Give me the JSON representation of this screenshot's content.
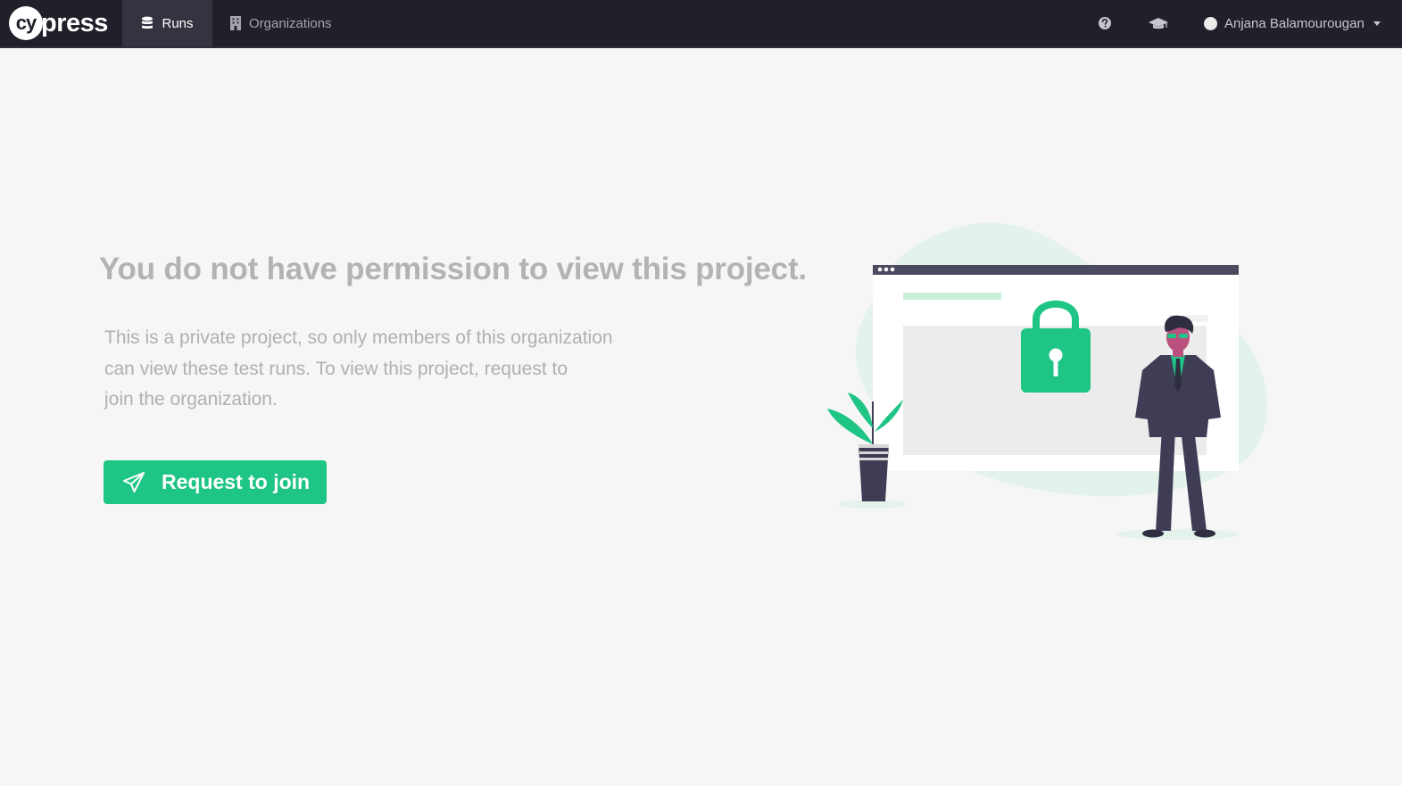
{
  "brand": {
    "logo_mark": "cy",
    "logo_text": "press"
  },
  "nav": {
    "items": [
      {
        "label": "Runs",
        "icon": "database-icon",
        "active": true
      },
      {
        "label": "Organizations",
        "icon": "building-icon",
        "active": false
      }
    ]
  },
  "header_icons": [
    "question-circle-icon",
    "graduation-cap-icon"
  ],
  "user": {
    "name": "Anjana Balamourougan"
  },
  "main": {
    "title": "You do not have permission to view this project.",
    "description_lines": [
      "This is a private project, so only members of this organization",
      "can view these test runs. To view this project, request to",
      "join the organization."
    ],
    "cta": {
      "label": "Request to join",
      "icon": "paper-plane-icon"
    }
  },
  "colors": {
    "topbar_bg": "#1f2029",
    "active_tab_bg": "#33343f",
    "accent_green": "#1fc585",
    "page_bg": "#f6f6f6",
    "muted_text": "#b3b3b3"
  }
}
